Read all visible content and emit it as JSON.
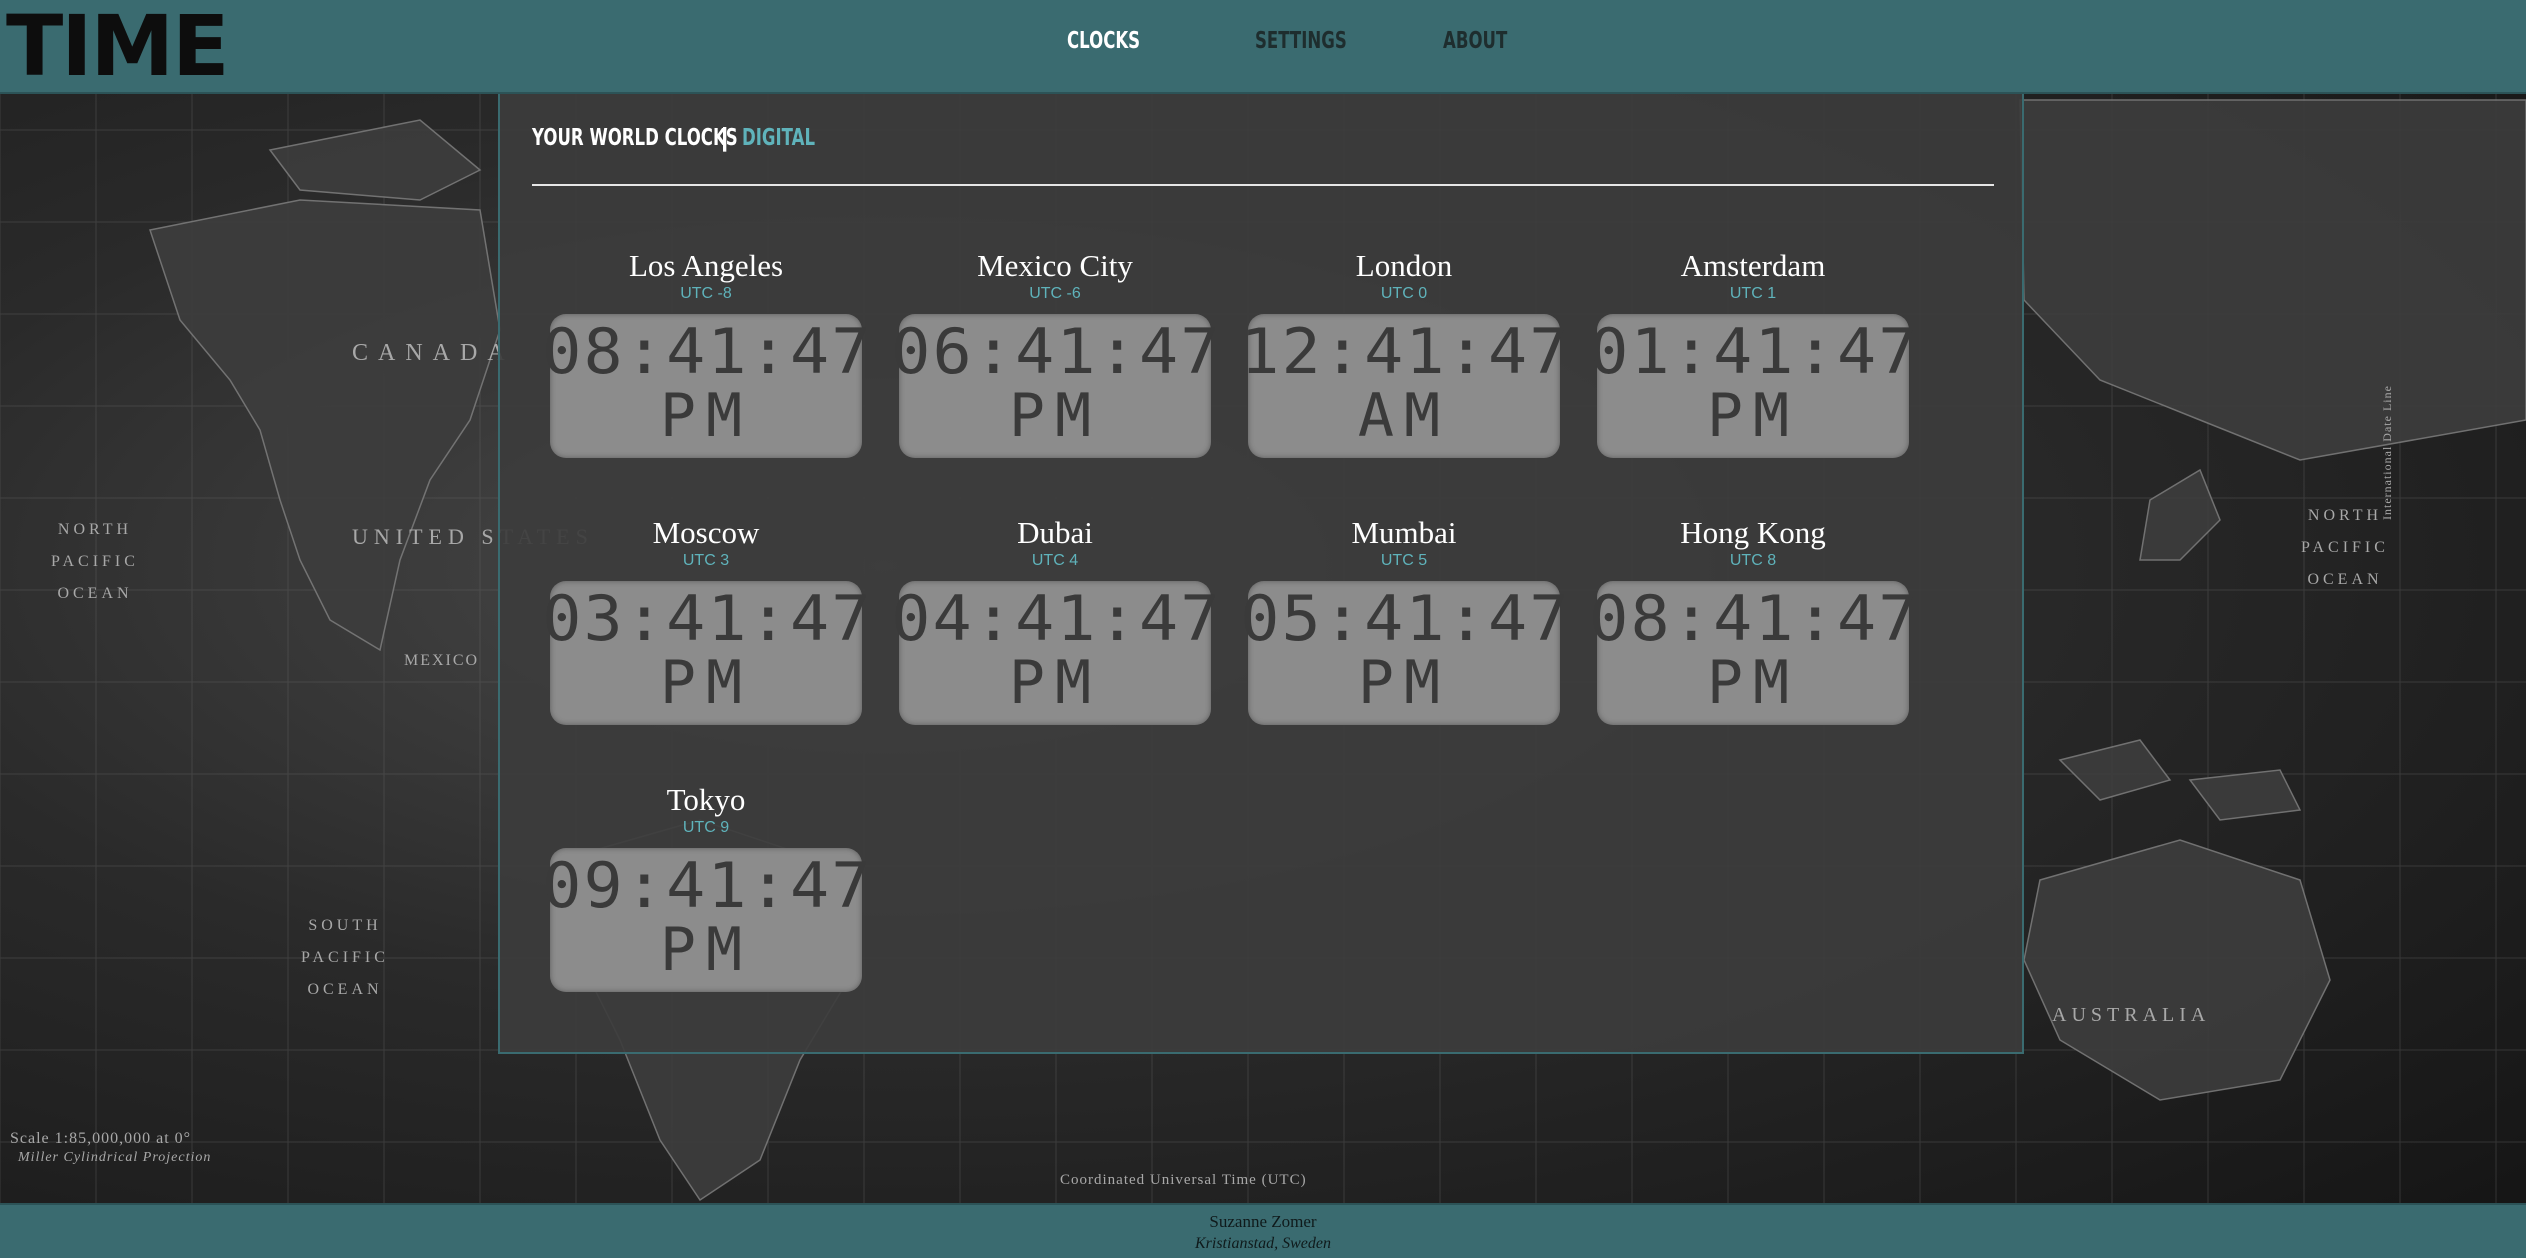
{
  "app": {
    "logo": "TIME"
  },
  "nav": {
    "items": [
      {
        "label": "CLOCKS",
        "active": true
      },
      {
        "label": "SETTINGS",
        "active": false
      },
      {
        "label": "ABOUT",
        "active": false
      }
    ]
  },
  "panel": {
    "title": "YOUR WORLD CLOCKS",
    "separator": "|",
    "mode": "DIGITAL"
  },
  "clocks": [
    {
      "city": "Los Angeles",
      "utc": "UTC -8",
      "time": "08:41:47",
      "ampm": "PM"
    },
    {
      "city": "Mexico City",
      "utc": "UTC -6",
      "time": "06:41:47",
      "ampm": "PM"
    },
    {
      "city": "London",
      "utc": "UTC 0",
      "time": "12:41:47",
      "ampm": "AM"
    },
    {
      "city": "Amsterdam",
      "utc": "UTC 1",
      "time": "01:41:47",
      "ampm": "PM"
    },
    {
      "city": "Moscow",
      "utc": "UTC 3",
      "time": "03:41:47",
      "ampm": "PM"
    },
    {
      "city": "Dubai",
      "utc": "UTC 4",
      "time": "04:41:47",
      "ampm": "PM"
    },
    {
      "city": "Mumbai",
      "utc": "UTC 5",
      "time": "05:41:47",
      "ampm": "PM"
    },
    {
      "city": "Hong Kong",
      "utc": "UTC 8",
      "time": "08:41:47",
      "ampm": "PM"
    },
    {
      "city": "Tokyo",
      "utc": "UTC 9",
      "time": "09:41:47",
      "ampm": "PM"
    }
  ],
  "map_labels": {
    "canada": "CANADA",
    "united_states": "UNITED STATES",
    "mexico": "MEXICO",
    "north_pacific_left": "NORTH PACIFIC OCEAN",
    "south_pacific": "SOUTH PACIFIC OCEAN",
    "australia": "AUSTRALIA",
    "north_pacific_right": "NORTH PACIFIC OCEAN",
    "scale": "Scale 1:85,000,000 at 0°",
    "projection": "Miller Cylindrical Projection",
    "coordinated": "Coordinated Universal Time (UTC)",
    "date_line": "International Date Line"
  },
  "footer": {
    "name": "Suzanne Zomer",
    "place": "Kristianstad, Sweden"
  },
  "colors": {
    "header": "#3a6b70",
    "accent": "#5fb3bb",
    "clock_face": "#8c8c8c",
    "panel": "#3c3c3c"
  }
}
